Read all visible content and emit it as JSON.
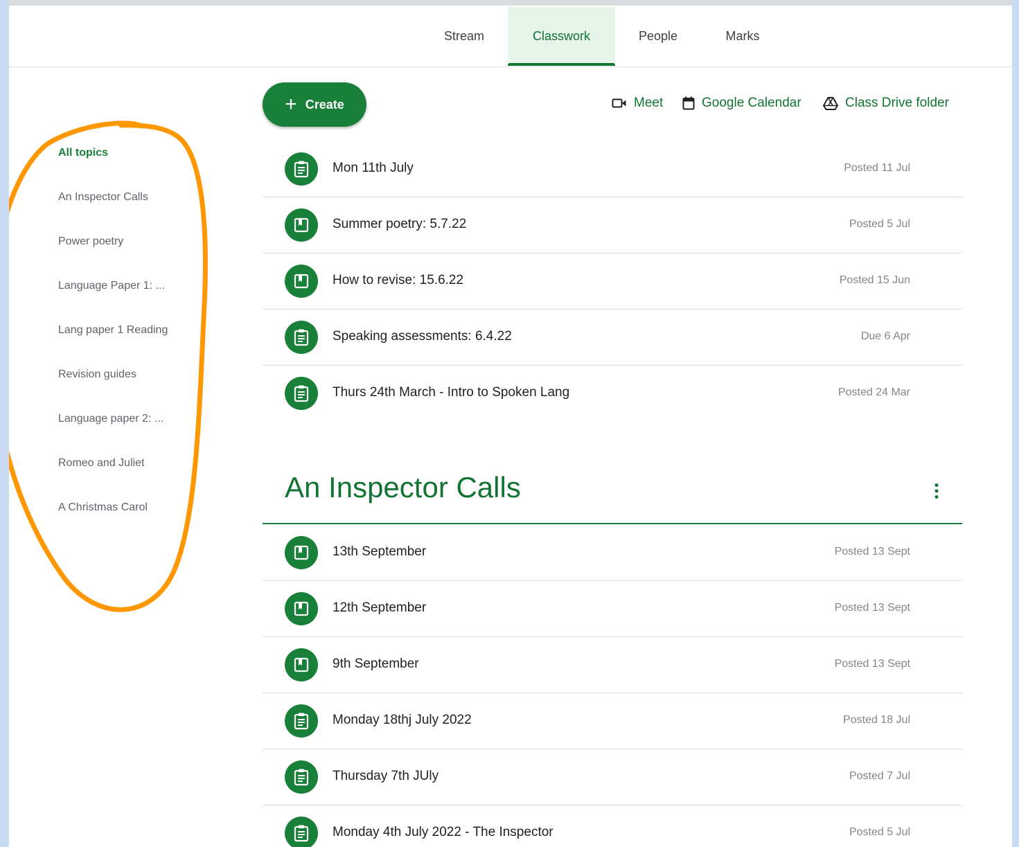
{
  "tabs": [
    {
      "label": "Stream"
    },
    {
      "label": "Classwork"
    },
    {
      "label": "People"
    },
    {
      "label": "Marks"
    }
  ],
  "toolbar": {
    "create_label": "Create",
    "meet_label": "Meet",
    "calendar_label": "Google Calendar",
    "drive_label": "Class Drive folder"
  },
  "sidebar": {
    "items": [
      {
        "label": "All topics"
      },
      {
        "label": "An Inspector Calls"
      },
      {
        "label": "Power poetry"
      },
      {
        "label": "Language Paper 1: ..."
      },
      {
        "label": "Lang paper 1 Reading"
      },
      {
        "label": "Revision guides"
      },
      {
        "label": "Language paper 2: ..."
      },
      {
        "label": "Romeo and Juliet"
      },
      {
        "label": "A Christmas Carol"
      }
    ]
  },
  "ungrouped": [
    {
      "title": "Mon 11th July",
      "date": "Posted 11 Jul",
      "icon": "assignment-icon"
    },
    {
      "title": "Summer poetry: 5.7.22",
      "date": "Posted 5 Jul",
      "icon": "material-icon"
    },
    {
      "title": "How to revise: 15.6.22",
      "date": "Posted 15 Jun",
      "icon": "material-icon"
    },
    {
      "title": "Speaking assessments: 6.4.22",
      "date": "Due 6 Apr",
      "icon": "assignment-icon"
    },
    {
      "title": "Thurs 24th March - Intro to Spoken Lang",
      "date": "Posted 24 Mar",
      "icon": "assignment-icon"
    }
  ],
  "section": {
    "title": "An Inspector Calls",
    "items": [
      {
        "title": "13th September",
        "date": "Posted 13 Sept",
        "icon": "material-icon"
      },
      {
        "title": "12th September",
        "date": "Posted 13 Sept",
        "icon": "material-icon"
      },
      {
        "title": "9th September",
        "date": "Posted 13 Sept",
        "icon": "material-icon"
      },
      {
        "title": "Monday 18thj July 2022",
        "date": "Posted 18 Jul",
        "icon": "assignment-icon"
      },
      {
        "title": "Thursday 7th JUly",
        "date": "Posted 7 Jul",
        "icon": "assignment-icon"
      },
      {
        "title": "Monday 4th July 2022 - The Inspector",
        "date": "Posted 5 Jul",
        "icon": "assignment-icon"
      }
    ]
  },
  "colors": {
    "accent": "#188038",
    "accent_dark": "#137333",
    "annotation": "#ff9800",
    "frame": "#c9dcf3"
  }
}
